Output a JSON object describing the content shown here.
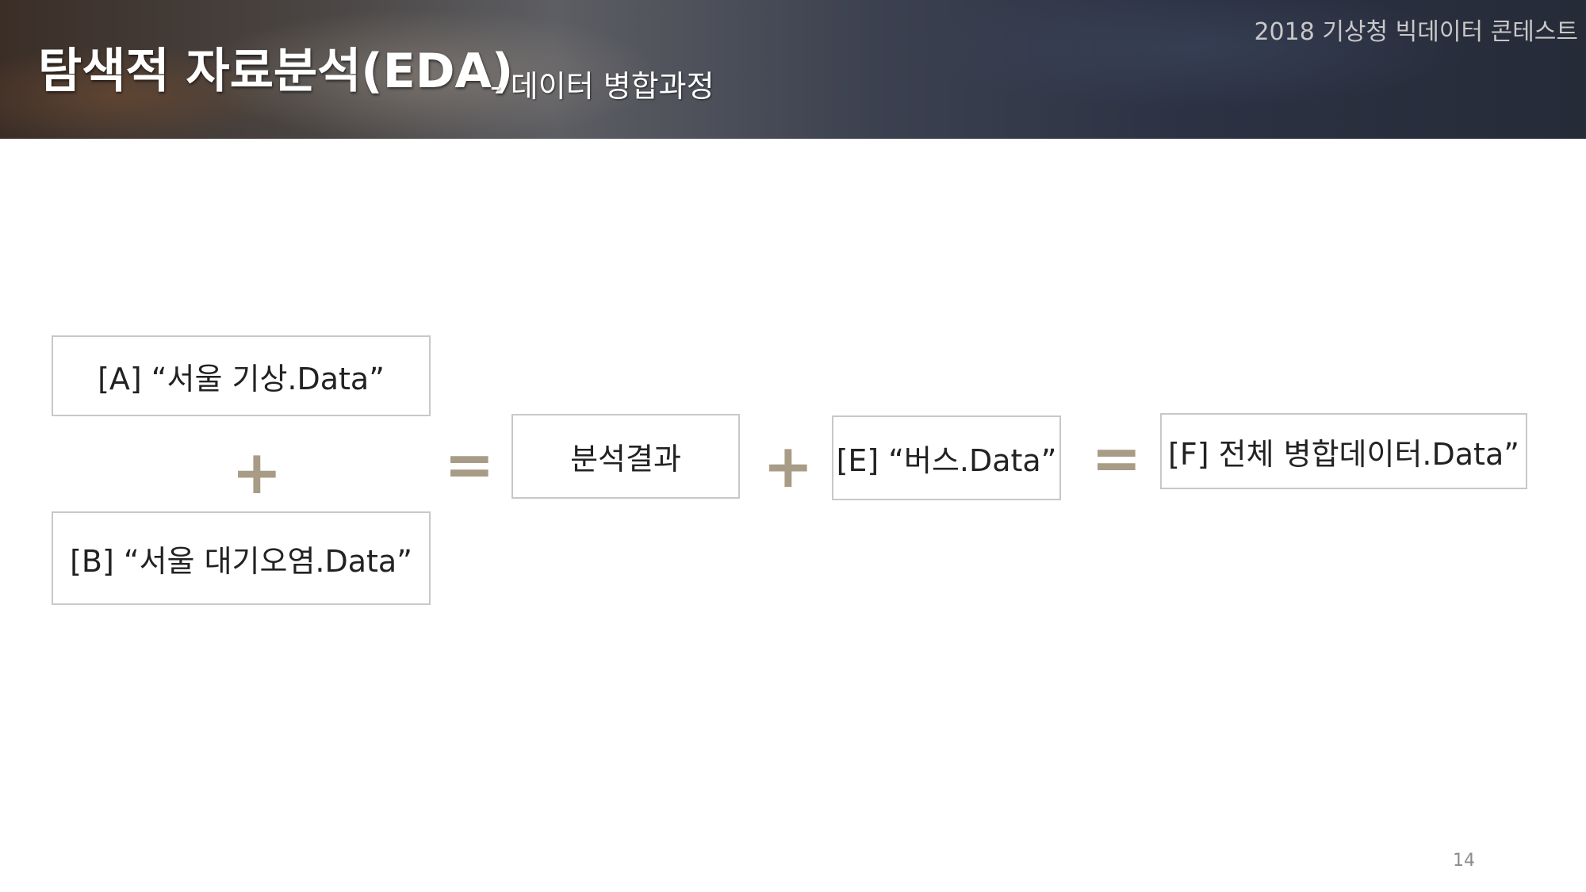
{
  "header": {
    "title": "탐색적 자료분석(EDA)",
    "subtitle": "- 데이터 병합과정",
    "contest": "2018 기상청 빅데이터 콘테스트"
  },
  "diagram": {
    "box_a": "[A] “서울 기상.Data”",
    "box_b": "[B] “서울 대기오염.Data”",
    "result": "분석결과",
    "box_e": "[E] “버스.Data”",
    "box_f": "[F] 전체 병합데이터.Data”",
    "plus": "+",
    "equals": "="
  },
  "footer": {
    "page_number": "14"
  },
  "colors": {
    "operator": "#a89c87",
    "box_border": "#c8c8c8"
  }
}
